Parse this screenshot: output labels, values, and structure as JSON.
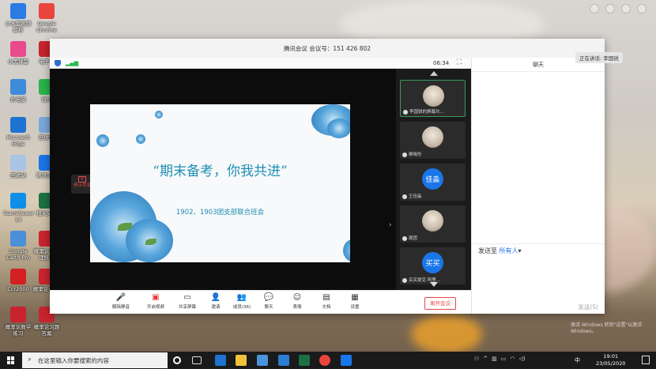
{
  "desktop": {
    "icons": [
      {
        "label": "小水管视频解析",
        "icon": "app-icon",
        "color": "#2a7be4"
      },
      {
        "label": "Google Chrome",
        "icon": "chrome-icon",
        "color": "#e8453c"
      },
      {
        "label": "小黑课堂",
        "icon": "app-icon",
        "color": "#e94a8c"
      },
      {
        "label": "电子书",
        "icon": "pdf-icon",
        "color": "#c8242e"
      },
      {
        "label": "此电脑",
        "icon": "computer-icon",
        "color": "#3d8bd9"
      },
      {
        "label": "微信",
        "icon": "wechat-icon",
        "color": "#2ab34a"
      },
      {
        "label": "Microsoft Edge",
        "icon": "edge-icon",
        "color": "#1e73d1"
      },
      {
        "label": "回收站",
        "icon": "app-icon",
        "color": "#7aa7d8"
      },
      {
        "label": "回收站",
        "icon": "recycle-bin-icon",
        "color": "#a9c4e4"
      },
      {
        "label": "腾讯会议",
        "icon": "meeting-icon",
        "color": "#1976e8"
      },
      {
        "label": "TeamViewer 14",
        "icon": "teamviewer-icon",
        "color": "#0e8ee9"
      },
      {
        "label": "相关文档",
        "icon": "excel-icon",
        "color": "#1d7044"
      },
      {
        "label": "Google Earth Pro",
        "icon": "earth-icon",
        "color": "#4a8fd8"
      },
      {
        "label": "概率论与数理统计",
        "icon": "pdf-icon",
        "color": "#c8242e"
      },
      {
        "label": "Ccr2000",
        "icon": "app-icon",
        "color": "#d42020"
      },
      {
        "label": "概率论40天",
        "icon": "pdf-icon",
        "color": "#c8242e"
      },
      {
        "label": "概率论数学练习",
        "icon": "pdf-icon",
        "color": "#c8242e"
      },
      {
        "label": "概率论习题答案",
        "icon": "pdf-icon",
        "color": "#c8242e"
      }
    ]
  },
  "meeting": {
    "window_title": "腾讯会议 会议号：151 426 802",
    "timer": "06:34",
    "stop_share_label": "停止共享",
    "slide": {
      "title": "“期末备考，你我共进”",
      "subtitle": "1902、1903团支部联合班会"
    },
    "participants": [
      {
        "name": "李国锐的屏幕共...",
        "avatar_text": "",
        "photo": true,
        "active": true
      },
      {
        "name": "柳晓彤",
        "avatar_text": "",
        "photo": true,
        "active": false
      },
      {
        "name": "王佳淼",
        "avatar_text": "佳淼",
        "photo": false,
        "active": false
      },
      {
        "name": "周团",
        "avatar_text": "",
        "photo": true,
        "active": false
      },
      {
        "name": "买买提克·阿里...",
        "avatar_text": "买买",
        "photo": false,
        "active": false
      }
    ],
    "toolbar": {
      "mute": "解除静音",
      "video": "开启视频",
      "share": "共享屏幕",
      "invite": "邀请",
      "members": "成员(36)",
      "chat": "聊天",
      "reactions": "表情",
      "docs": "文档",
      "settings": "设置",
      "leave": "离开会议"
    },
    "chat": {
      "title": "聊天",
      "send_to_label": "发送至",
      "send_to_target": "所有人",
      "send_button": "发送(S)"
    },
    "speaking_label": "正在讲话: 李国锐"
  },
  "watermark": "激活 Windows 转到\"设置\"以激活 Windows。",
  "taskbar": {
    "search_placeholder": "在这里输入你要搜索的内容",
    "ime": "中",
    "time": "19:01",
    "date": "23/05/2020"
  }
}
